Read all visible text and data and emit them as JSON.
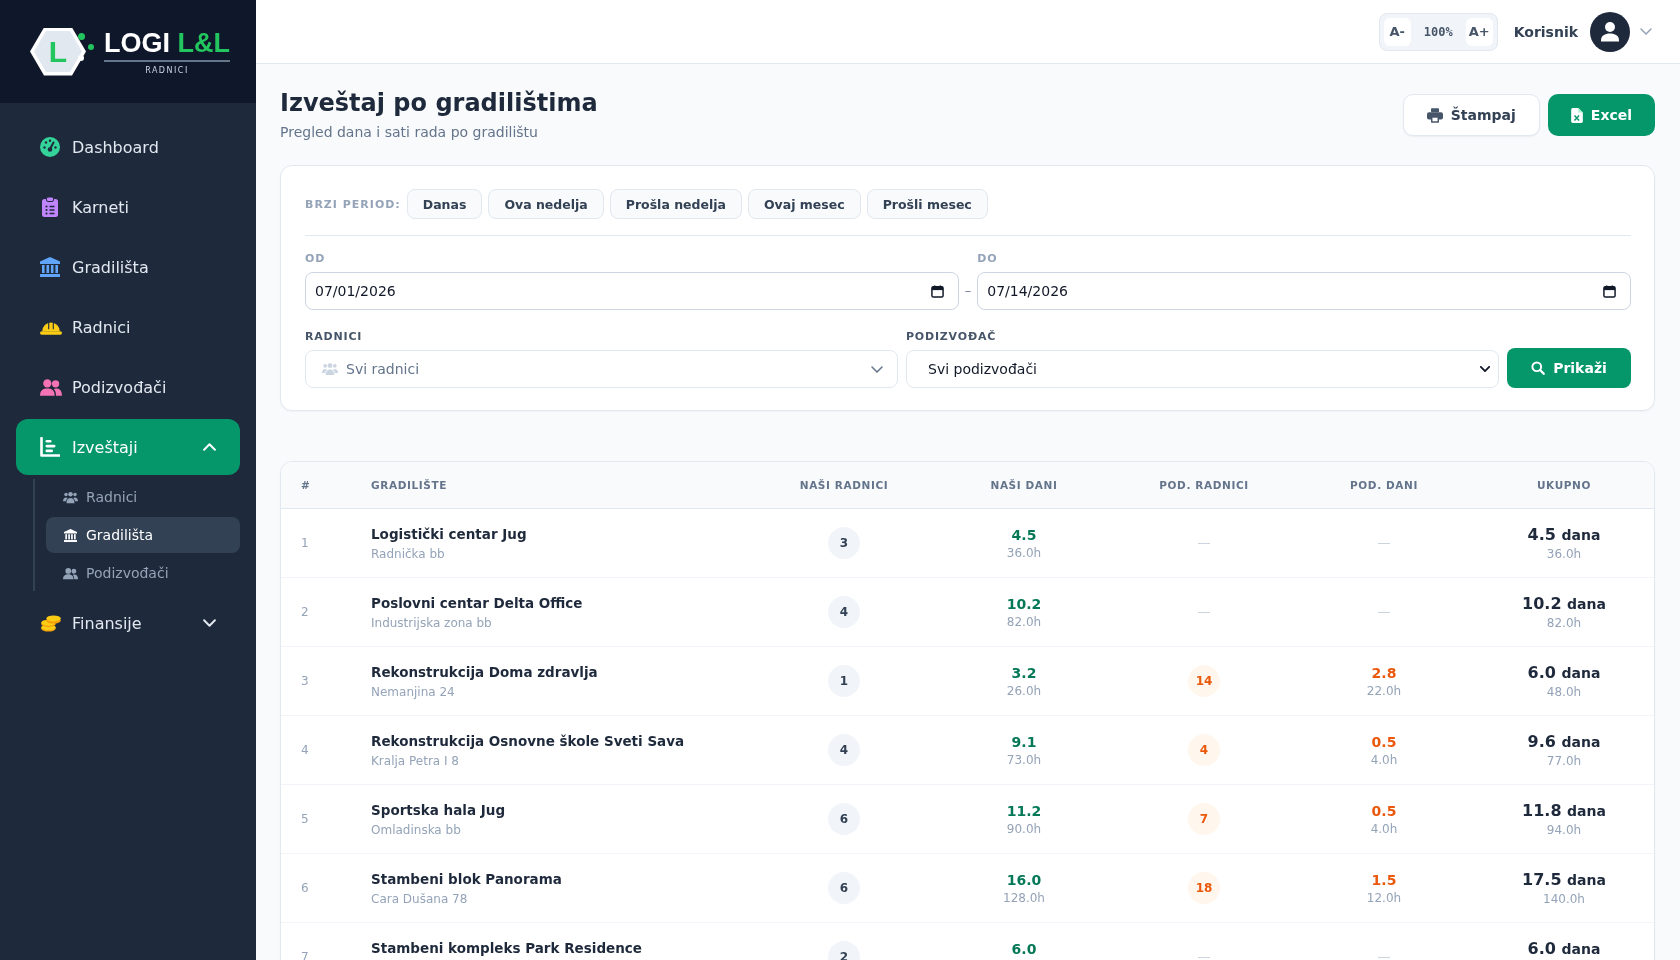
{
  "sidebar": {
    "brand": {
      "mark": "L",
      "name": "LOGI",
      "accent": "L&L",
      "tagline": "RADNICI"
    },
    "items": [
      {
        "label": "Dashboard",
        "selected": false
      },
      {
        "label": "Karneti",
        "selected": false
      },
      {
        "label": "Gradilišta",
        "selected": false
      },
      {
        "label": "Radnici",
        "selected": false
      },
      {
        "label": "Podizvođači",
        "selected": false
      },
      {
        "label": "Izveštaji",
        "selected": true,
        "expanded": true,
        "children": [
          {
            "label": "Radnici",
            "selected": false
          },
          {
            "label": "Gradilišta",
            "selected": true
          },
          {
            "label": "Podizvođači",
            "selected": false
          }
        ]
      },
      {
        "label": "Finansije",
        "selected": false,
        "expanded": false
      }
    ]
  },
  "topbar": {
    "font_size": {
      "decrease": "A-",
      "value": "100%",
      "increase": "A+"
    },
    "user": {
      "name": "Korisnik"
    }
  },
  "page": {
    "title": "Izveštaj po gradilištima",
    "subtitle": "Pregled dana i sati rada po gradilištu",
    "actions": [
      {
        "label": "Štampaj",
        "kind": "secondary"
      },
      {
        "label": "Excel",
        "kind": "primary"
      }
    ]
  },
  "filters": {
    "quick_period": {
      "label": "BRZI PERIOD:",
      "options": [
        {
          "label": "Danas",
          "selected": false
        },
        {
          "label": "Ova nedelja",
          "selected": false
        },
        {
          "label": "Prošla nedelja",
          "selected": false
        },
        {
          "label": "Ovaj mesec",
          "selected": false
        },
        {
          "label": "Prošli mesec",
          "selected": false
        }
      ]
    },
    "date_from": {
      "label": "OD",
      "value": "07/01/2026"
    },
    "range_separator": "–",
    "date_to": {
      "label": "DO",
      "value": "07/14/2026"
    },
    "workers": {
      "label": "RADNICI",
      "placeholder": "Svi radnici"
    },
    "subcontractor": {
      "label": "PODIZVOĐAČ",
      "value": "Svi podizvođači"
    },
    "submit": {
      "label": "Prikaži"
    }
  },
  "table": {
    "columns": [
      "#",
      "GRADILIŠTE",
      "NAŠI RADNICI",
      "NAŠI DANI",
      "POD. RADNICI",
      "POD. DANI",
      "UKUPNO"
    ],
    "rows": [
      {
        "number": "1",
        "site": "Logistički centar Jug",
        "address": "Radnička bb",
        "our_workers": "3",
        "our_days": "4.5",
        "our_hours": "36.0h",
        "total_days": "4.5",
        "total_unit": "dana",
        "total_hours": "36.0h"
      },
      {
        "number": "2",
        "site": "Poslovni centar Delta Office",
        "address": "Industrijska zona bb",
        "our_workers": "4",
        "our_days": "10.2",
        "our_hours": "82.0h",
        "total_days": "10.2",
        "total_unit": "dana",
        "total_hours": "82.0h"
      },
      {
        "number": "3",
        "site": "Rekonstrukcija Doma zdravlja",
        "address": "Nemanjina 24",
        "our_workers": "1",
        "our_days": "3.2",
        "our_hours": "26.0h",
        "sub_workers": "14",
        "sub_days": "2.8",
        "sub_hours": "22.0h",
        "total_days": "6.0",
        "total_unit": "dana",
        "total_hours": "48.0h"
      },
      {
        "number": "4",
        "site": "Rekonstrukcija Osnovne škole Sveti Sava",
        "address": "Kralja Petra I 8",
        "our_workers": "4",
        "our_days": "9.1",
        "our_hours": "73.0h",
        "sub_workers": "4",
        "sub_days": "0.5",
        "sub_hours": "4.0h",
        "total_days": "9.6",
        "total_unit": "dana",
        "total_hours": "77.0h"
      },
      {
        "number": "5",
        "site": "Sportska hala Jug",
        "address": "Omladinska bb",
        "our_workers": "6",
        "our_days": "11.2",
        "our_hours": "90.0h",
        "sub_workers": "7",
        "sub_days": "0.5",
        "sub_hours": "4.0h",
        "total_days": "11.8",
        "total_unit": "dana",
        "total_hours": "94.0h"
      },
      {
        "number": "6",
        "site": "Stambeni blok Panorama",
        "address": "Cara Dušana 78",
        "our_workers": "6",
        "our_days": "16.0",
        "our_hours": "128.0h",
        "sub_workers": "18",
        "sub_days": "1.5",
        "sub_hours": "12.0h",
        "total_days": "17.5",
        "total_unit": "dana",
        "total_hours": "140.0h"
      },
      {
        "number": "7",
        "site": "Stambeni kompleks Park Residence",
        "our_workers": "2",
        "our_days": "6.0",
        "total_days": "6.0",
        "total_unit": "dana"
      }
    ]
  }
}
